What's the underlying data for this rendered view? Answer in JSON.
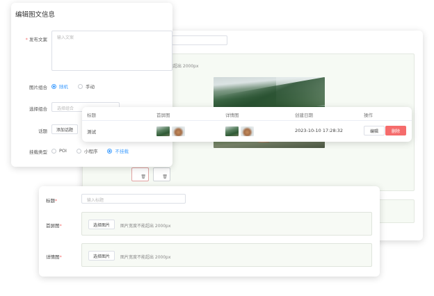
{
  "back_form": {
    "hint_partial": "宽不能超出 2000px"
  },
  "edit_dialog": {
    "title": "编辑图文信息",
    "content_label": "发布文案",
    "content_placeholder": "输入文案",
    "image_combo_label": "图片组合",
    "image_combo_options": [
      "随机",
      "手动"
    ],
    "select_combo_label": "选择组合",
    "select_combo_placeholder": "选择组合",
    "topic_label": "话题",
    "add_topic_button": "添加话题",
    "mount_type_label": "挂载类型",
    "mount_type_options": [
      "POI",
      "小程序",
      "不挂载"
    ]
  },
  "table": {
    "columns": [
      "标题",
      "首屏图",
      "详情图",
      "创建日期",
      "操作"
    ],
    "rows": [
      {
        "title": "测试",
        "created": "2023-10-10 17:28:32",
        "edit": "编辑",
        "delete": "删除"
      }
    ]
  },
  "bottom_form": {
    "title_label": "标题",
    "title_placeholder": "输入标题",
    "first_image_label": "首屏图",
    "detail_image_label": "详情图",
    "choose_image_button": "选择图片",
    "size_hint": "图片宽度不能超出 2000px"
  },
  "colors": {
    "primary": "#409eff",
    "danger": "#f56c6c",
    "required": "#f56c6c"
  }
}
